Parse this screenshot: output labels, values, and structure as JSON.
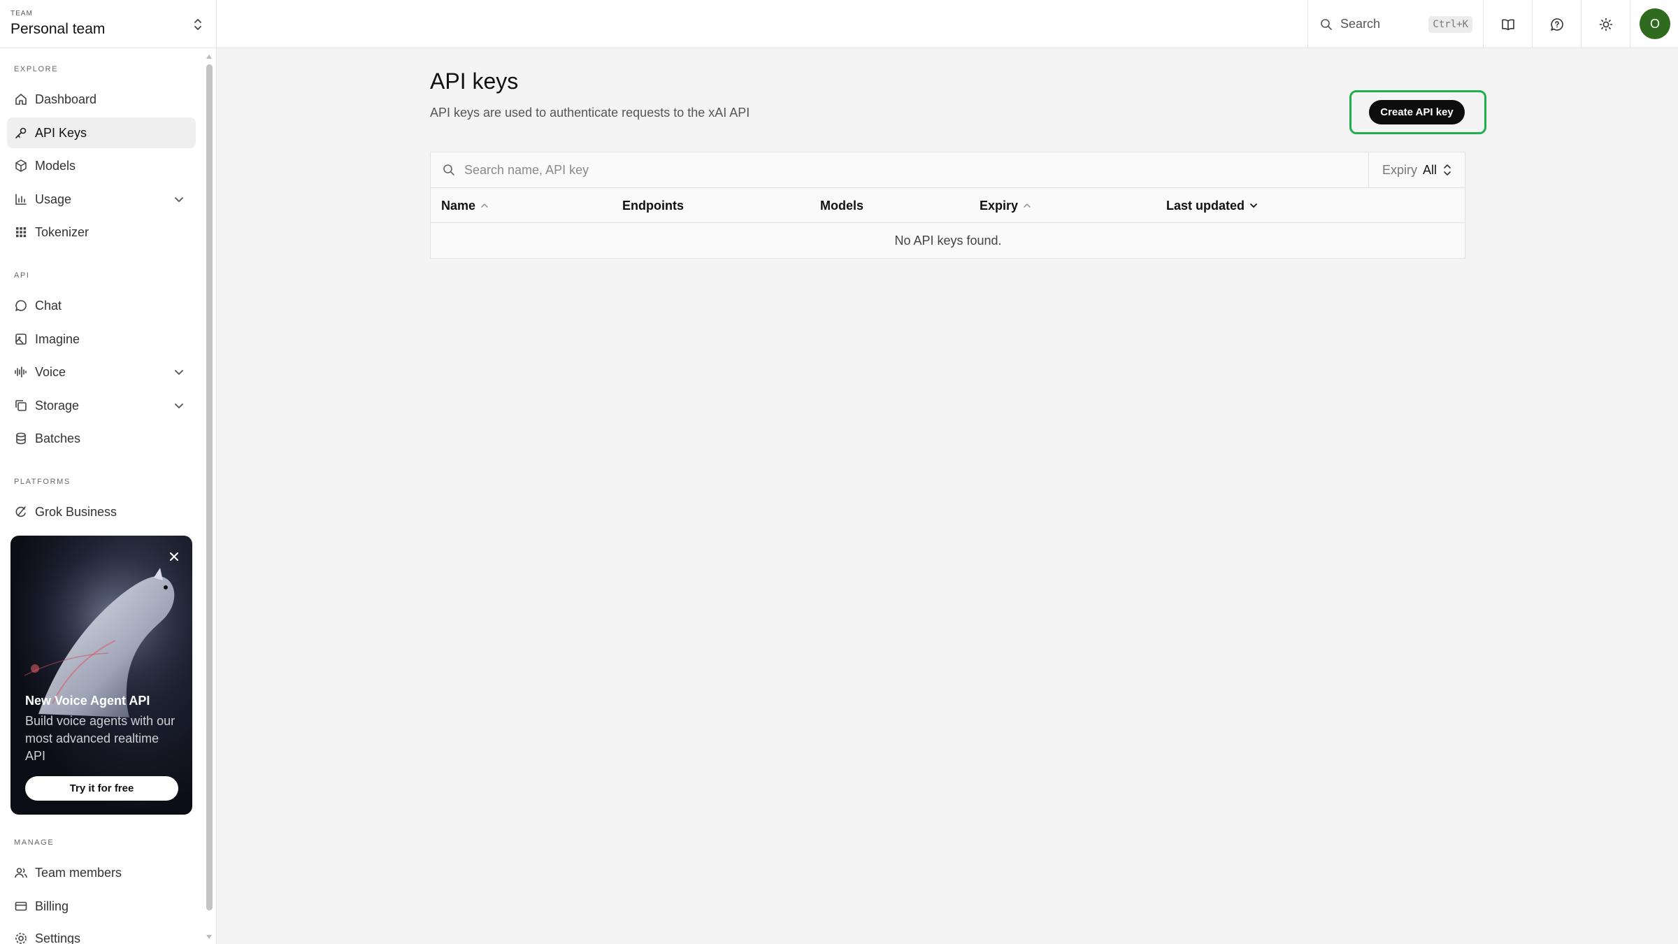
{
  "team": {
    "caption": "TEAM",
    "name": "Personal team"
  },
  "sidebar": {
    "sections": {
      "explore": "EXPLORE",
      "api": "API",
      "platforms": "PLATFORMS",
      "manage": "MANAGE"
    },
    "items": {
      "dashboard": "Dashboard",
      "api_keys": "API Keys",
      "models": "Models",
      "usage": "Usage",
      "tokenizer": "Tokenizer",
      "chat": "Chat",
      "imagine": "Imagine",
      "voice": "Voice",
      "storage": "Storage",
      "batches": "Batches",
      "grok_business": "Grok Business",
      "team_members": "Team members",
      "billing": "Billing",
      "settings": "Settings"
    },
    "active": "API Keys"
  },
  "promo": {
    "title": "New Voice Agent API",
    "description": "Build voice agents with our most advanced realtime API",
    "cta": "Try it for free"
  },
  "topbar": {
    "search_label": "Search",
    "shortcut": "Ctrl+K",
    "avatar_initial": "O"
  },
  "main": {
    "title": "API keys",
    "subtitle": "API keys are used to authenticate requests to the xAI API",
    "create_button": "Create API key",
    "search_placeholder": "Search name, API key",
    "expiry_filter": {
      "label": "Expiry",
      "value": "All"
    },
    "columns": [
      "Name",
      "Endpoints",
      "Models",
      "Expiry",
      "Last updated"
    ],
    "empty_message": "No API keys found."
  },
  "colors": {
    "highlight_outline": "#20b04b",
    "avatar_bg": "#2f6b1e",
    "button_bg": "#0d0d0d"
  }
}
